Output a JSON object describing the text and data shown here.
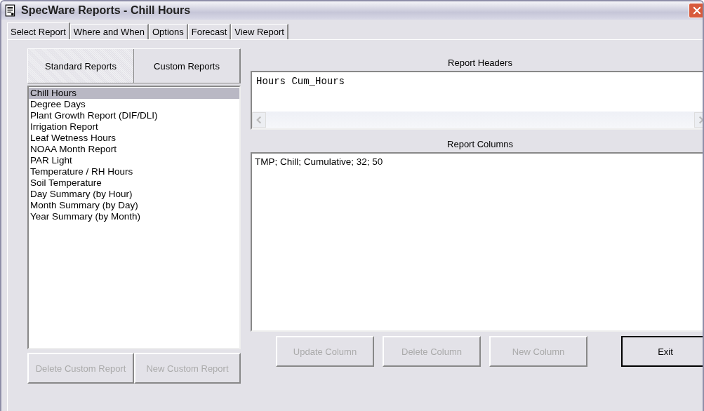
{
  "window": {
    "title": "SpecWare Reports - Chill Hours"
  },
  "tabs": [
    {
      "label": "Select Report",
      "selected": true
    },
    {
      "label": "Where and When",
      "selected": false
    },
    {
      "label": "Options",
      "selected": false
    },
    {
      "label": "Forecast",
      "selected": false
    },
    {
      "label": "View Report",
      "selected": false
    }
  ],
  "report_tabs": [
    {
      "label": "Standard Reports",
      "selected": true
    },
    {
      "label": "Custom Reports",
      "selected": false
    }
  ],
  "reports": [
    {
      "label": "Chill Hours",
      "selected": true
    },
    {
      "label": "Degree Days",
      "selected": false
    },
    {
      "label": "Plant Growth Report (DIF/DLI)",
      "selected": false
    },
    {
      "label": "Irrigation Report",
      "selected": false
    },
    {
      "label": "Leaf Wetness Hours",
      "selected": false
    },
    {
      "label": "NOAA Month Report",
      "selected": false
    },
    {
      "label": "PAR Light",
      "selected": false
    },
    {
      "label": "Temperature / RH Hours",
      "selected": false
    },
    {
      "label": "Soil Temperature",
      "selected": false
    },
    {
      "label": "Day Summary (by Hour)",
      "selected": false
    },
    {
      "label": "Month Summary (by Day)",
      "selected": false
    },
    {
      "label": "Year Summary (by Month)",
      "selected": false
    }
  ],
  "report_buttons": [
    {
      "label": "Delete Custom Report",
      "disabled": true
    },
    {
      "label": "New Custom Report",
      "disabled": true
    }
  ],
  "report_headers": {
    "label": "Report Headers",
    "value": "Hours Cum_Hours"
  },
  "report_columns": {
    "label": "Report Columns",
    "items": [
      "TMP; Chill; Cumulative; 32; 50"
    ]
  },
  "column_buttons": [
    {
      "label": "Update Column",
      "disabled": true
    },
    {
      "label": "Delete Column",
      "disabled": true
    },
    {
      "label": "New Column",
      "disabled": true
    },
    {
      "label": "Exit",
      "disabled": false
    }
  ]
}
